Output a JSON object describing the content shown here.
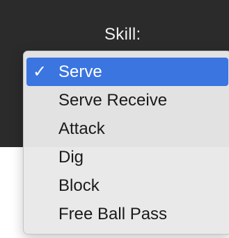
{
  "header": {
    "label": "Skill:"
  },
  "dropdown": {
    "selected_index": 0,
    "checkmark": "✓",
    "items": [
      {
        "label": "Serve"
      },
      {
        "label": "Serve Receive"
      },
      {
        "label": "Attack"
      },
      {
        "label": "Dig"
      },
      {
        "label": "Block"
      },
      {
        "label": "Free Ball Pass"
      }
    ]
  },
  "colors": {
    "header_bg": "#2b2b2b",
    "menu_bg": "#e8e8e8",
    "highlight": "#3a75e0",
    "text": "#1a1a1a"
  }
}
